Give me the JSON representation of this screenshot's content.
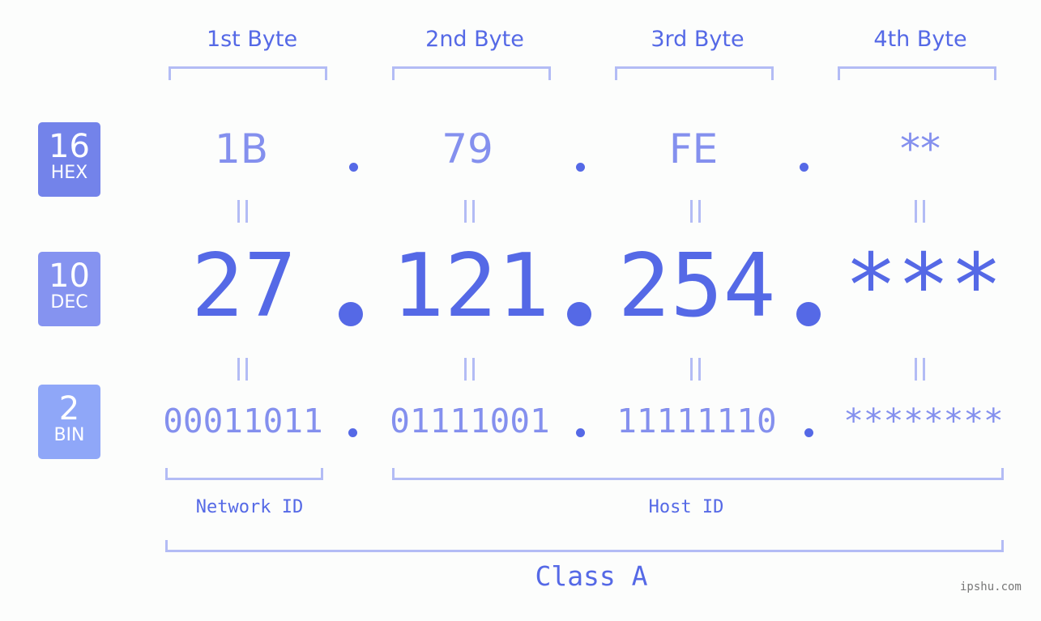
{
  "byte_headers": [
    "1st Byte",
    "2nd Byte",
    "3rd Byte",
    "4th Byte"
  ],
  "badges": [
    {
      "number": "16",
      "label": "HEX",
      "color": "#7383ea"
    },
    {
      "number": "10",
      "label": "DEC",
      "color": "#8593f0"
    },
    {
      "number": "2",
      "label": "BIN",
      "color": "#8fa7f8"
    }
  ],
  "hex_values": [
    "1B",
    "79",
    "FE",
    "**"
  ],
  "dec_values": [
    "27",
    "121",
    "254",
    "***"
  ],
  "bin_values": [
    "00011011",
    "01111001",
    "11111110",
    "********"
  ],
  "network_id_label": "Network ID",
  "host_id_label": "Host ID",
  "class_label": "Class A",
  "watermark": "ipshu.com",
  "colors": {
    "accent": "#5569e6",
    "light_accent": "#8490ee",
    "bracket": "#b3bcf5",
    "background": "#fcfdfc"
  }
}
